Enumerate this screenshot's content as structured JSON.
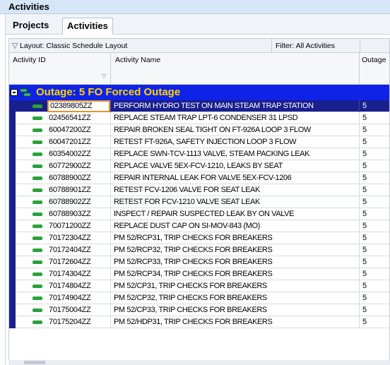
{
  "window": {
    "title": "Activities"
  },
  "tabs": [
    {
      "label": "Projects",
      "active": false
    },
    {
      "label": "Activities",
      "active": true
    }
  ],
  "layout_bar": {
    "layout_label": "Layout: Classic Schedule Layout",
    "filter_label": "Filter: All Activities"
  },
  "columns": {
    "activity_id": "Activity ID",
    "activity_name": "Activity Name",
    "outage": "Outage"
  },
  "group": {
    "label": "Outage: 5  FO Forced Outage",
    "color": "#0f23e6",
    "text_color": "#ffd400"
  },
  "rows": [
    {
      "id": "02389805ZZ",
      "name": "PERFORM HYDRO TEST ON MAIN STEAM TRAP STATION",
      "outage": "5",
      "selected": true
    },
    {
      "id": "02456541ZZ",
      "name": "REPLACE STEAM TRAP LPT-6 CONDENSER 31 LPSD",
      "outage": "5"
    },
    {
      "id": "60047200ZZ",
      "name": "REPAIR BROKEN SEAL TIGHT ON FT-926A LOOP 3 FLOW",
      "outage": "5"
    },
    {
      "id": "60047201ZZ",
      "name": "RETEST FT-926A, SAFETY INJECTION LOOP 3 FLOW",
      "outage": "5"
    },
    {
      "id": "60354002ZZ",
      "name": "REPLACE SWN-TCV-1113 VALVE,  STEAM PACKING LEAK",
      "outage": "5"
    },
    {
      "id": "60772900ZZ",
      "name": "REPLACE VALVE 5EX-FCV-1210, LEAKS BY SEAT",
      "outage": "5"
    },
    {
      "id": "60788900ZZ",
      "name": "REPAIR INTERNAL LEAK FOR VALVE 5EX-FCV-1206",
      "outage": "5"
    },
    {
      "id": "60788901ZZ",
      "name": "RETEST FCV-1206  VALVE FOR SEAT LEAK",
      "outage": "5"
    },
    {
      "id": "60788902ZZ",
      "name": "RETEST FOR FCV-1210 VALVE SEAT LEAK",
      "outage": "5"
    },
    {
      "id": "60788903ZZ",
      "name": "INSPECT / REPAIR SUSPECTED LEAK BY ON VALVE",
      "outage": "5"
    },
    {
      "id": "70071200ZZ",
      "name": "REPLACE DUST CAP ON SI-MOV-843 (MO)",
      "outage": "5"
    },
    {
      "id": "70172304ZZ",
      "name": "PM 52/RCP31, TRIP CHECKS FOR BREAKERS",
      "outage": "5"
    },
    {
      "id": "70172404ZZ",
      "name": "PM 52/RCP32, TRIP CHECKS FOR BREAKERS",
      "outage": "5"
    },
    {
      "id": "70172604ZZ",
      "name": "PM 52/RCP33, TRIP CHECKS FOR BREAKERS",
      "outage": "5"
    },
    {
      "id": "70174304ZZ",
      "name": "PM 52/RCP34, TRIP CHECKS FOR BREAKERS",
      "outage": "5"
    },
    {
      "id": "70174804ZZ",
      "name": "PM 52/CP31, TRIP CHECKS FOR BREAKERS",
      "outage": "5"
    },
    {
      "id": "70174904ZZ",
      "name": "PM 52/CP32, TRIP CHECKS FOR BREAKERS",
      "outage": "5"
    },
    {
      "id": "70175004ZZ",
      "name": "PM 52/CP33, TRIP CHECKS FOR BREAKERS",
      "outage": "5"
    },
    {
      "id": "70175204ZZ",
      "name": "PM 52/HDP31, TRIP CHECKS FOR BREAKERS",
      "outage": "5"
    }
  ],
  "icons": {
    "activity_bar": "activity-bar-icon",
    "group_collapse": "collapse-box-icon",
    "group": "group-icon",
    "filter": "chevron-down-icon",
    "sort": "sort-icon"
  },
  "colors": {
    "selected_row": "#1a1f8e",
    "selection_border": "#e6922a",
    "activity_bar": "#2aa33a"
  }
}
